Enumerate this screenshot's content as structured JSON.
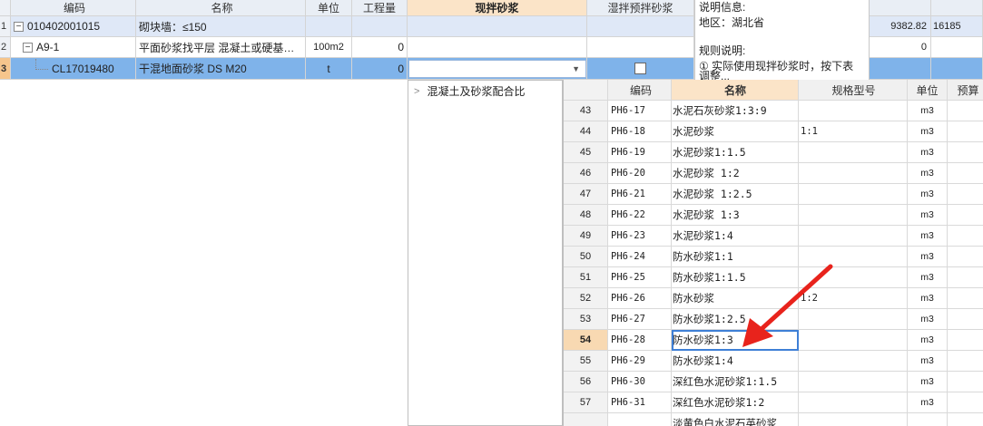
{
  "main_grid": {
    "columns": {
      "bm": "编码",
      "mc": "名称",
      "dw": "单位",
      "gcl": "工程量",
      "xb": "现拌砂浆",
      "sb": "湿拌预拌砂浆"
    },
    "rows": [
      {
        "no": "1",
        "bm": "010402001015",
        "mc": "砌块墙：≤150",
        "dw": "",
        "gcl": ""
      },
      {
        "no": "2",
        "bm": "A9-1",
        "mc": "平面砂浆找平层 混凝土或硬基…",
        "dw": "100m2",
        "gcl": "0"
      },
      {
        "no": "3",
        "bm": "CL17019480",
        "mc": "干混地面砂浆 DS M20",
        "dw": "t",
        "gcl": "0"
      }
    ],
    "toggle_minus": "−",
    "combo_arrow": "▼"
  },
  "info_panel": {
    "line1": "说明信息:",
    "line2": "地区：湖北省",
    "line3": "规则说明:",
    "line4": "① 实际使用现拌砂浆时，按下表",
    "line5": "调整..."
  },
  "far_right": {
    "r1a": "9382.82",
    "r1b": "16185",
    "r2a": "0"
  },
  "tree": {
    "arrow": ">",
    "label": "混凝土及砂浆配合比"
  },
  "list": {
    "columns": {
      "bm": "编码",
      "mc": "名称",
      "gg": "规格型号",
      "dw": "单位",
      "ys": "预算"
    },
    "rows": [
      {
        "no": "43",
        "bm": "PH6-17",
        "mc": "水泥石灰砂浆1:3:9",
        "gg": "",
        "dw": "m3"
      },
      {
        "no": "44",
        "bm": "PH6-18",
        "mc": "水泥砂浆",
        "gg": "1:1",
        "dw": "m3"
      },
      {
        "no": "45",
        "bm": "PH6-19",
        "mc": "水泥砂浆1:1.5",
        "gg": "",
        "dw": "m3"
      },
      {
        "no": "46",
        "bm": "PH6-20",
        "mc": "水泥砂浆 1:2",
        "gg": "",
        "dw": "m3"
      },
      {
        "no": "47",
        "bm": "PH6-21",
        "mc": "水泥砂浆 1:2.5",
        "gg": "",
        "dw": "m3"
      },
      {
        "no": "48",
        "bm": "PH6-22",
        "mc": "水泥砂浆 1:3",
        "gg": "",
        "dw": "m3"
      },
      {
        "no": "49",
        "bm": "PH6-23",
        "mc": "水泥砂浆1:4",
        "gg": "",
        "dw": "m3"
      },
      {
        "no": "50",
        "bm": "PH6-24",
        "mc": "防水砂浆1:1",
        "gg": "",
        "dw": "m3"
      },
      {
        "no": "51",
        "bm": "PH6-25",
        "mc": "防水砂浆1:1.5",
        "gg": "",
        "dw": "m3"
      },
      {
        "no": "52",
        "bm": "PH6-26",
        "mc": "防水砂浆",
        "gg": "1:2",
        "dw": "m3"
      },
      {
        "no": "53",
        "bm": "PH6-27",
        "mc": "防水砂浆1:2.5",
        "gg": "",
        "dw": "m3"
      },
      {
        "no": "54",
        "bm": "PH6-28",
        "mc": "防水砂浆1:3",
        "gg": "",
        "dw": "m3"
      },
      {
        "no": "55",
        "bm": "PH6-29",
        "mc": "防水砂浆1:4",
        "gg": "",
        "dw": "m3"
      },
      {
        "no": "56",
        "bm": "PH6-30",
        "mc": "深红色水泥砂浆1:1.5",
        "gg": "",
        "dw": "m3"
      },
      {
        "no": "57",
        "bm": "PH6-31",
        "mc": "深红色水泥砂浆1:2",
        "gg": "",
        "dw": "m3"
      },
      {
        "no": "",
        "bm": "",
        "mc": "淡黄色白水泥石英砂浆",
        "gg": "",
        "dw": ""
      }
    ],
    "selected_no": "54"
  },
  "colors": {
    "selected_row": "#7fb3ea",
    "header_highlight": "#fbe4c8",
    "annotation_arrow": "#e8231c"
  }
}
